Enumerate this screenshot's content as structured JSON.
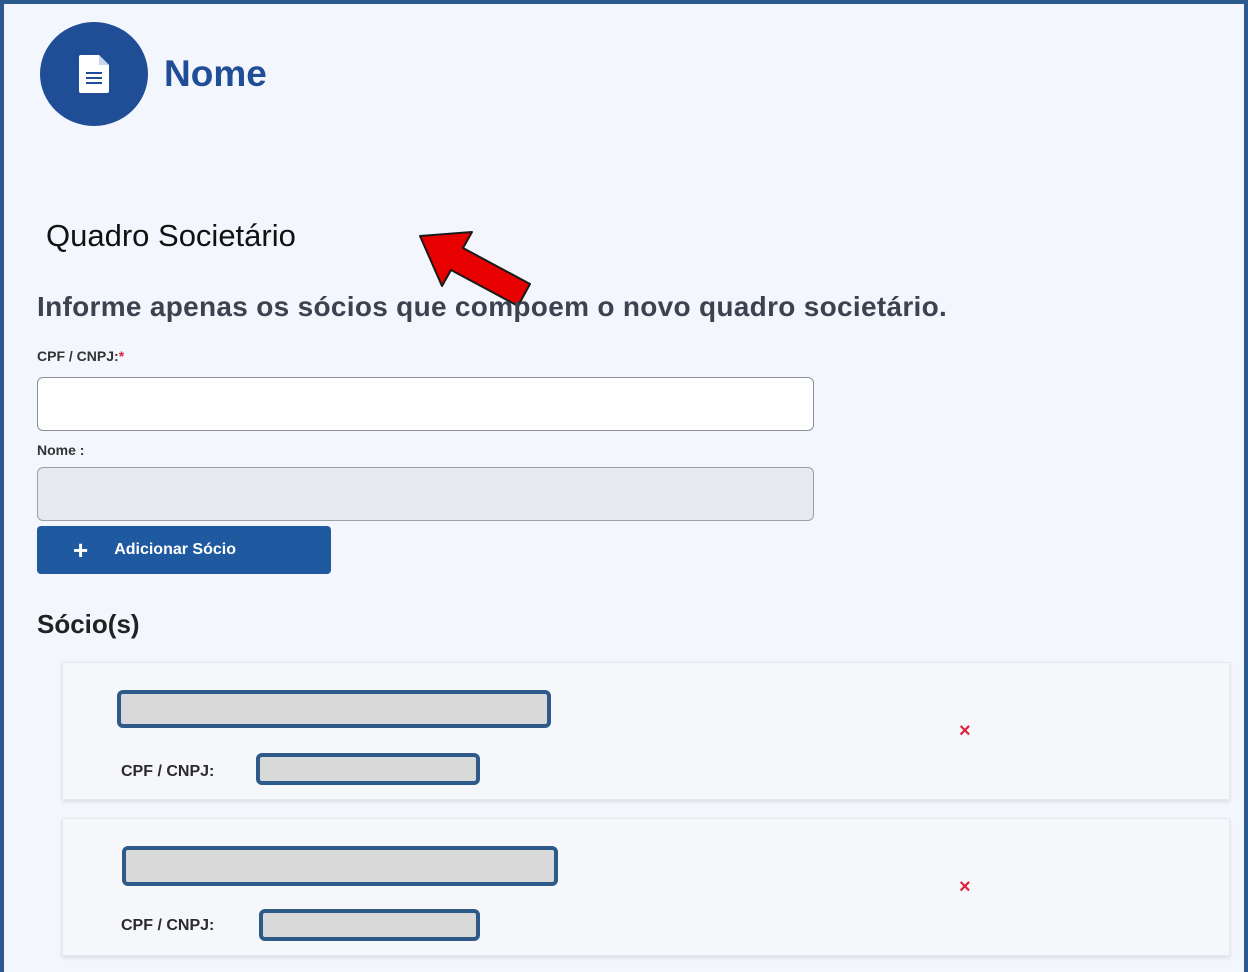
{
  "header": {
    "title": "Nome",
    "logo_icon": "document-icon"
  },
  "section": {
    "title": "Quadro Societário"
  },
  "instructions": "Informe apenas os sócios que compoem o novo quadro societário.",
  "form": {
    "cpf_label": "CPF / CNPJ:",
    "cpf_required_mark": "*",
    "cpf_value": "",
    "nome_label": "Nome :",
    "nome_value": ""
  },
  "add_button": {
    "label": "Adicionar Sócio",
    "icon": "plus-icon"
  },
  "socios": {
    "title": "Sócio(s)",
    "items": [
      {
        "cpf_label": "CPF / CNPJ:",
        "remove_icon": "×"
      },
      {
        "cpf_label": "CPF / CNPJ:",
        "remove_icon": "×"
      }
    ]
  },
  "colors": {
    "brand": "#1f4e96",
    "button": "#1f5aa0",
    "required": "#e0213b",
    "annotation_arrow": "#e60000",
    "redaction_border": "#2e5a8a"
  }
}
